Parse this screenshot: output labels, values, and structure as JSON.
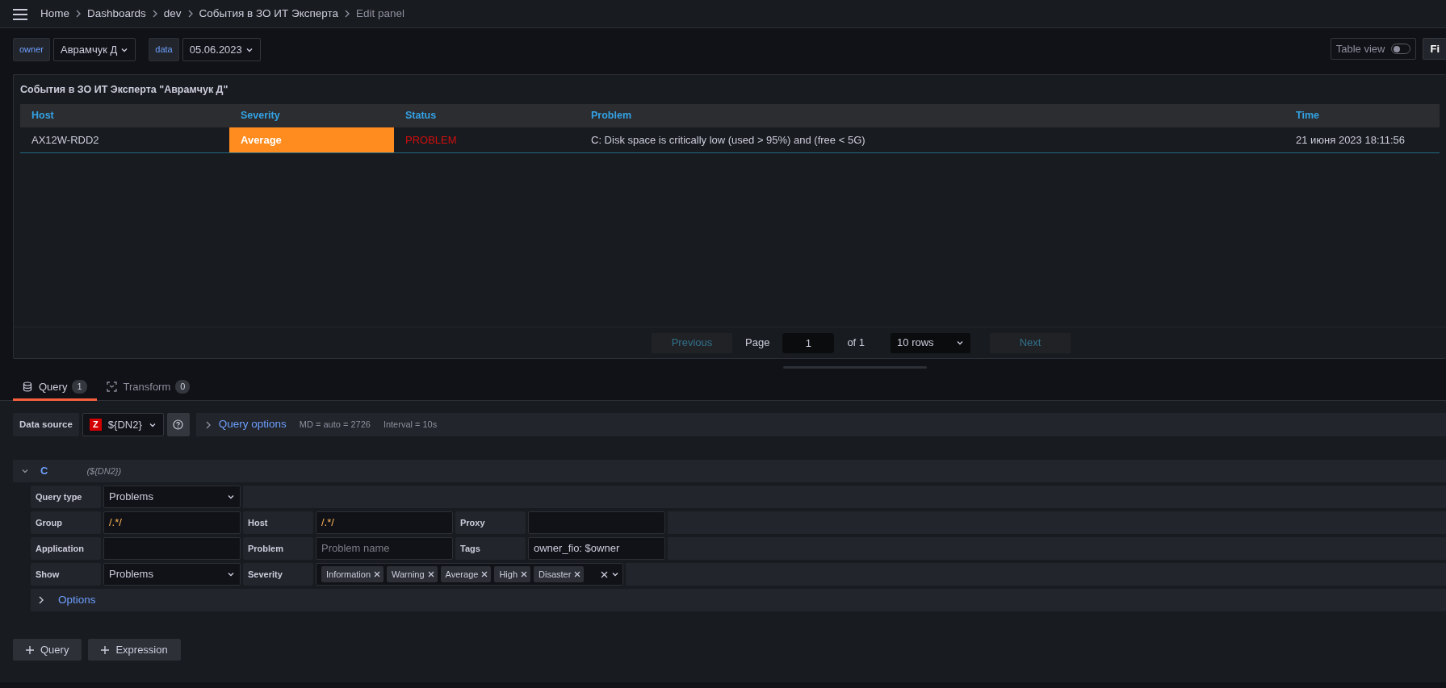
{
  "breadcrumbs": [
    {
      "label": "Home",
      "current": false
    },
    {
      "label": "Dashboards",
      "current": false
    },
    {
      "label": "dev",
      "current": false
    },
    {
      "label": "События в ЗО ИТ Эксперта",
      "current": false
    },
    {
      "label": "Edit panel",
      "current": true
    }
  ],
  "variables": [
    {
      "label": "owner",
      "value": "Аврамчук Д"
    },
    {
      "label": "data",
      "value": "05.06.2023"
    }
  ],
  "table_view": {
    "label": "Table view",
    "on": false
  },
  "cut_button": {
    "label": "Fi"
  },
  "panel": {
    "title": "События в ЗО ИТ Эксперта \"Аврамчук Д\"",
    "table": {
      "columns": [
        "Host",
        "Severity",
        "Status",
        "Problem",
        "Time"
      ],
      "rows": [
        {
          "host": "AX12W-RDD2",
          "severity": "Average",
          "color": "#ff8c1f",
          "status": "PROBLEM",
          "problem": "C: Disk space is critically low (used > 95%) and (free < 5G)",
          "time": "21 июня 2023 18:11:56"
        }
      ]
    },
    "pagination": {
      "previous": "Previous",
      "page_label": "Page",
      "page": "1",
      "of": "of 1",
      "rows": "10 rows",
      "next": "Next"
    }
  },
  "tabs": [
    {
      "label": "Query",
      "count": "1",
      "selected": true,
      "kind": "database"
    },
    {
      "label": "Transform",
      "count": "0",
      "selected": false,
      "kind": "transform"
    }
  ],
  "data_source": {
    "label": "Data source",
    "logo": "Z",
    "value": "${DN2}"
  },
  "query_options": {
    "label": "Query options",
    "expanded": false,
    "md": "MD = auto = 2726",
    "interval": "Interval = 10s"
  },
  "query": {
    "ref": "C",
    "source": "(${DN2})",
    "expanded": true,
    "rows": [
      [
        {
          "label": "Query type",
          "kind": "select",
          "value": "Problems"
        }
      ],
      [
        {
          "label": "Group",
          "kind": "input",
          "value": "/.*/",
          "regex": true
        },
        {
          "label": "Host",
          "kind": "input",
          "value": "/.*/",
          "regex": true
        },
        {
          "label": "Proxy",
          "kind": "input"
        }
      ],
      [
        {
          "label": "Application",
          "kind": "input"
        },
        {
          "label": "Problem",
          "kind": "input",
          "placeholder": "Problem name"
        },
        {
          "label": "Tags",
          "kind": "input",
          "value": "owner_fio: $owner",
          "regex": false
        }
      ],
      [
        {
          "label": "Show",
          "kind": "select",
          "value": "Problems"
        },
        {
          "label": "Severity",
          "kind": "tags",
          "tags": [
            "Information",
            "Warning",
            "Average",
            "High",
            "Disaster"
          ]
        }
      ]
    ],
    "options": {
      "label": "Options",
      "expanded": false
    }
  },
  "buttons": [
    "Query",
    "Expression"
  ]
}
